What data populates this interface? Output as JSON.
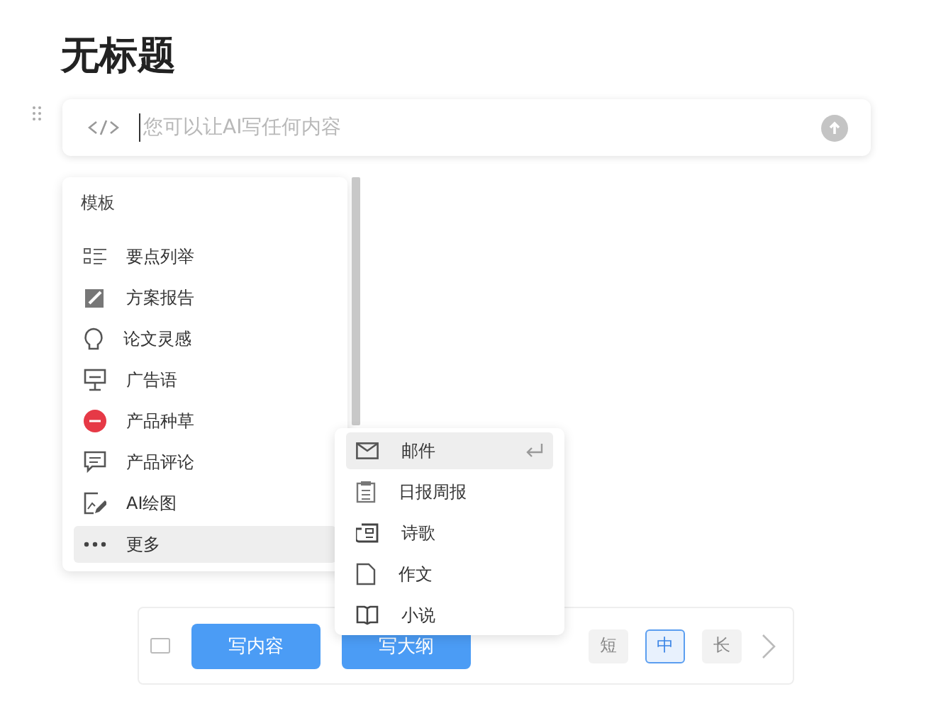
{
  "title": "无标题",
  "prompt": {
    "placeholder": "您可以让AI写任何内容"
  },
  "templates": {
    "heading": "模板",
    "items": [
      {
        "label": "要点列举",
        "selected": false
      },
      {
        "label": "方案报告",
        "selected": false
      },
      {
        "label": "论文灵感",
        "selected": false
      },
      {
        "label": "广告语",
        "selected": false
      },
      {
        "label": "产品种草",
        "selected": false
      },
      {
        "label": "产品评论",
        "selected": false
      },
      {
        "label": "AI绘图",
        "selected": false
      },
      {
        "label": "更多",
        "selected": true
      }
    ]
  },
  "more_menu": [
    {
      "label": "邮件",
      "selected": true
    },
    {
      "label": "日报周报",
      "selected": false
    },
    {
      "label": "诗歌",
      "selected": false
    },
    {
      "label": "作文",
      "selected": false
    },
    {
      "label": "小说",
      "selected": false
    }
  ],
  "actions": [
    "写内容",
    "写大纲"
  ],
  "lengths": [
    {
      "label": "短",
      "selected": false
    },
    {
      "label": "中",
      "selected": true
    },
    {
      "label": "长",
      "selected": false
    }
  ]
}
